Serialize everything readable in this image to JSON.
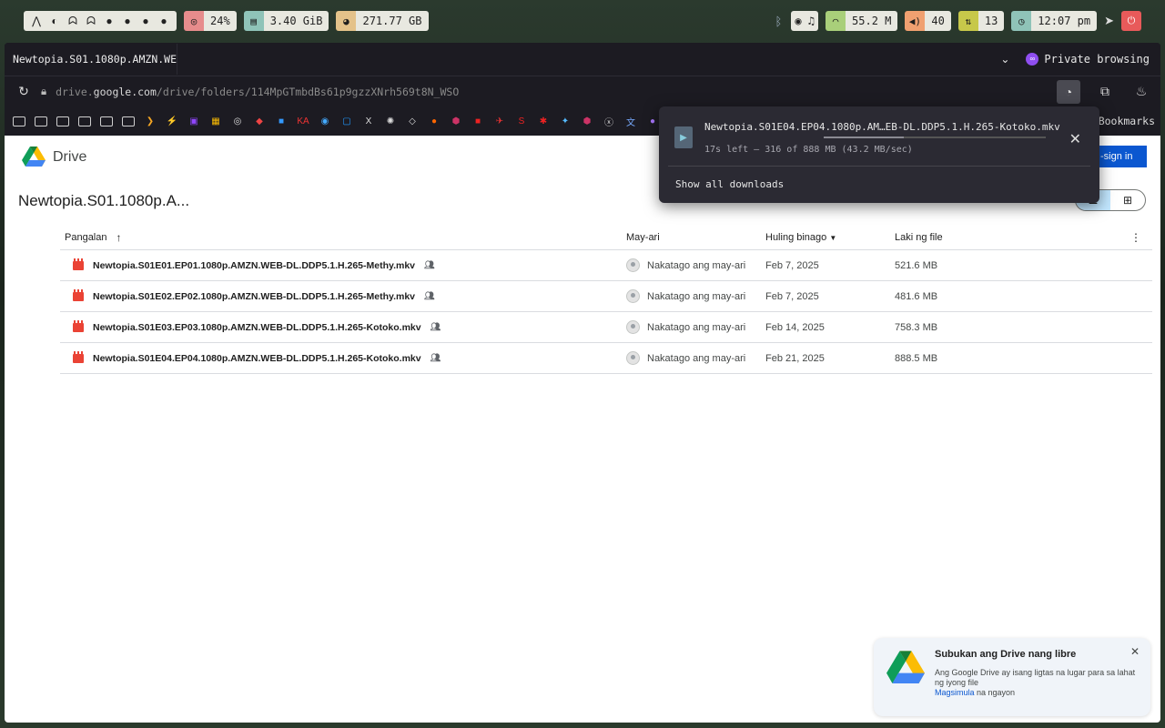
{
  "topbar": {
    "workspaces": [
      "⋀",
      "◐",
      "ᗣ",
      "ᗣ",
      "●",
      "●",
      "●",
      "●"
    ],
    "cpu": "24%",
    "ram": "3.40 GiB",
    "disk": "271.77 GB",
    "wifi": "55.2 M",
    "volume": "40",
    "updates": "13",
    "time": "12:07 pm",
    "colors": {
      "cpu": "#e78c8c",
      "ram": "#8fc3b8",
      "disk": "#e4c28a",
      "wifi": "#a9cf7a",
      "volume": "#f0a070",
      "updates": "#c7c84a",
      "time": "#8fc3b8",
      "power": "#e85a5a"
    }
  },
  "browser": {
    "tab_title": "Newtopia.S01.1080p.AMZN.WEB",
    "private_label": "Private browsing",
    "url_prefix": "drive.",
    "url_domain": "google.com",
    "url_path": "/drive/folders/114MpGTmbdBs61p9gzzXNrh569t8N_WSO",
    "bookmarks_label": "Bookmarks"
  },
  "download": {
    "filename": "Newtopia.S01E04.EP04.1080p.AM…EB-DL.DDP5.1.H.265-Kotoko.mkv",
    "status": "17s left — 316 of 888 MB (43.2 MB/sec)",
    "progress": 0.36,
    "show_all": "Show all downloads"
  },
  "drive": {
    "app_name": "Drive",
    "signin_label": "-sign in",
    "folder_title": "Newtopia.S01.1080p.A...",
    "columns": {
      "name": "Pangalan",
      "owner": "May-ari",
      "modified": "Huling binago",
      "size": "Laki ng file"
    },
    "files": [
      {
        "name": "Newtopia.S01E01.EP01.1080p.AMZN.WEB-DL.DDP5.1.H.265-Methy.mkv",
        "owner": "Nakatago ang may-ari",
        "modified": "Feb 7, 2025",
        "size": "521.6 MB"
      },
      {
        "name": "Newtopia.S01E02.EP02.1080p.AMZN.WEB-DL.DDP5.1.H.265-Methy.mkv",
        "owner": "Nakatago ang may-ari",
        "modified": "Feb 7, 2025",
        "size": "481.6 MB"
      },
      {
        "name": "Newtopia.S01E03.EP03.1080p.AMZN.WEB-DL.DDP5.1.H.265-Kotoko.mkv",
        "owner": "Nakatago ang may-ari",
        "modified": "Feb 14, 2025",
        "size": "758.3 MB"
      },
      {
        "name": "Newtopia.S01E04.EP04.1080p.AMZN.WEB-DL.DDP5.1.H.265-Kotoko.mkv",
        "owner": "Nakatago ang may-ari",
        "modified": "Feb 21, 2025",
        "size": "888.5 MB"
      }
    ],
    "promo": {
      "title": "Subukan ang Drive nang libre",
      "body": "Ang Google Drive ay isang ligtas na lugar para sa lahat ng iyong file",
      "link": "Magsimula",
      "link_suffix": " na ngayon"
    }
  }
}
